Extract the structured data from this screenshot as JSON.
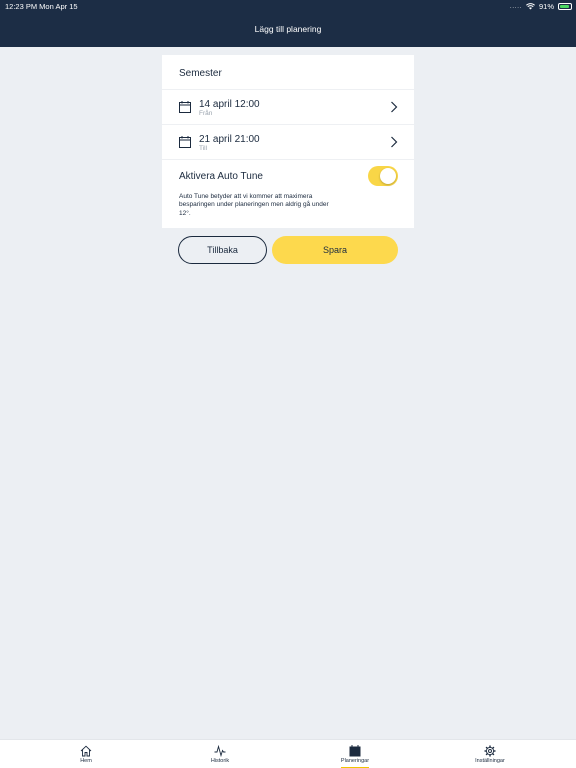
{
  "status_bar": {
    "time_date": "12:23 PM   Mon Apr 15",
    "battery": "91%",
    "battery_level": 0.91,
    "signal": "....."
  },
  "header": {
    "title": "Lägg till planering"
  },
  "form": {
    "name": "Semester",
    "from": {
      "date": "14 april 12:00",
      "label": "Från"
    },
    "to": {
      "date": "21 april 21:00",
      "label": "Till"
    },
    "auto_tune": {
      "label": "Aktivera Auto Tune",
      "enabled": true,
      "description": "Auto Tune betyder att vi kommer att maximera besparingen under planeringen men aldrig gå under 12°."
    }
  },
  "actions": {
    "back_label": "Tillbaka",
    "save_label": "Spara"
  },
  "tabs": [
    {
      "label": "Hem",
      "icon": "home-icon",
      "active": false
    },
    {
      "label": "Historik",
      "icon": "activity-icon",
      "active": false
    },
    {
      "label": "Planeringar",
      "icon": "calendar-icon",
      "active": true
    },
    {
      "label": "Inställningar",
      "icon": "gear-icon",
      "active": false
    }
  ],
  "colors": {
    "header_bg": "#1c2d45",
    "accent": "#fdd94d",
    "text": "#1b2a3e",
    "background": "#eceff3"
  }
}
